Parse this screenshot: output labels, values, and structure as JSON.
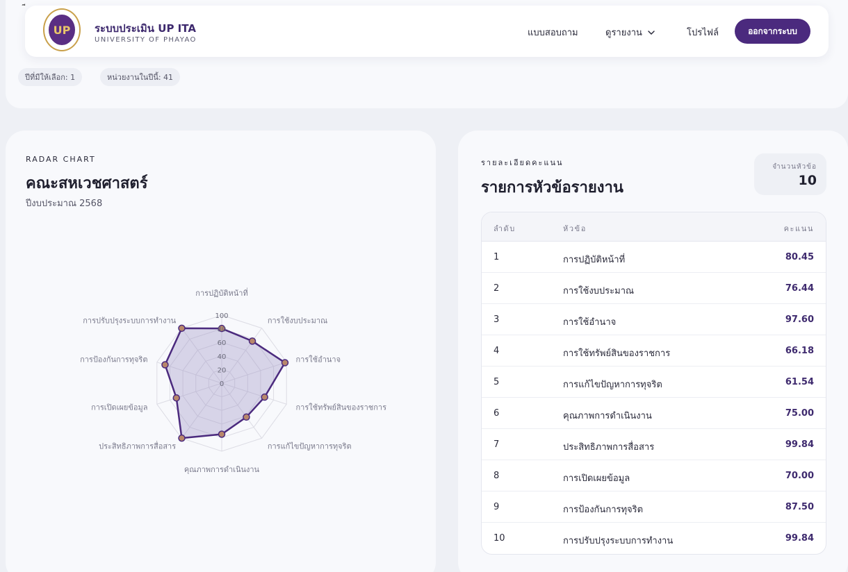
{
  "header": {
    "brand_title": "ระบบประเมิน UP ITA",
    "brand_subtitle": "UNIVERSITY OF PHAYAO",
    "logo_text": "UP",
    "stray_mark": "ี",
    "nav": {
      "survey": "แบบสอบถาม",
      "report": "ดูรายงาน",
      "profile": "โปรไฟล์",
      "logout": "ออกจากระบบ"
    }
  },
  "chips": {
    "years": "ปีที่มีให้เลือก: 1",
    "units": "หน่วยงานในปีนี้: 41"
  },
  "left_card": {
    "eyebrow": "RADAR CHART",
    "title": "คณะสหเวชศาสตร์",
    "subtitle": "ปีงบประมาณ 2568"
  },
  "right_card": {
    "eyebrow": "รายละเอียดคะแนน",
    "title": "รายการหัวข้อรายงาน",
    "count_label": "จำนวนหัวข้อ",
    "count_value": "10",
    "columns": {
      "index": "ลำดับ",
      "topic": "หัวข้อ",
      "score": "คะแนน"
    },
    "rows": [
      {
        "index": "1",
        "topic": "การปฏิบัติหน้าที่",
        "score": "80.45"
      },
      {
        "index": "2",
        "topic": "การใช้งบประมาณ",
        "score": "76.44"
      },
      {
        "index": "3",
        "topic": "การใช้อำนาจ",
        "score": "97.60"
      },
      {
        "index": "4",
        "topic": "การใช้ทรัพย์สินของราชการ",
        "score": "66.18"
      },
      {
        "index": "5",
        "topic": "การแก้ไขปัญหาการทุจริต",
        "score": "61.54"
      },
      {
        "index": "6",
        "topic": "คุณภาพการดำเนินงาน",
        "score": "75.00"
      },
      {
        "index": "7",
        "topic": "ประสิทธิภาพการสื่อสาร",
        "score": "99.84"
      },
      {
        "index": "8",
        "topic": "การเปิดเผยข้อมูล",
        "score": "70.00"
      },
      {
        "index": "9",
        "topic": "การป้องกันการทุจริต",
        "score": "87.50"
      },
      {
        "index": "10",
        "topic": "การปรับปรุงระบบการทำงาน",
        "score": "99.84"
      }
    ]
  },
  "chart_data": {
    "type": "radar",
    "categories": [
      "การปฏิบัติหน้าที่",
      "การใช้งบประมาณ",
      "การใช้อำนาจ",
      "การใช้ทรัพย์สินของราชการ",
      "การแก้ไขปัญหาการทุจริต",
      "คุณภาพการดำเนินงาน",
      "ประสิทธิภาพการสื่อสาร",
      "การเปิดเผยข้อมูล",
      "การป้องกันการทุจริต",
      "การปรับปรุงระบบการทำงาน"
    ],
    "values": [
      80.45,
      76.44,
      97.6,
      66.18,
      61.54,
      75.0,
      99.84,
      70.0,
      87.5,
      99.84
    ],
    "ticks": [
      0,
      20,
      40,
      60,
      80,
      100
    ],
    "rlim": [
      0,
      100
    ],
    "grid": true,
    "colors": {
      "line": "#4b2a7e",
      "fill": "#9b8fc4",
      "marker": "#b8876a",
      "grid": "#dcdce4"
    }
  }
}
